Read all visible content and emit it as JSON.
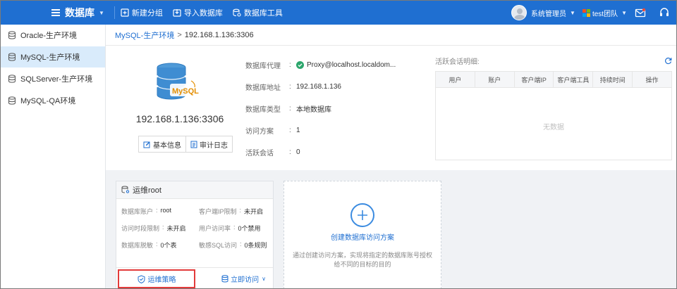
{
  "topbar": {
    "title": "数据库",
    "tools": [
      "新建分组",
      "导入数据库",
      "数据库工具"
    ],
    "user": "系统管理员",
    "team": "test团队"
  },
  "sidebar": {
    "items": [
      {
        "label": "Oracle-生产环境"
      },
      {
        "label": "MySQL-生产环境"
      },
      {
        "label": "SQLServer-生产环境"
      },
      {
        "label": "MySQL-QA环境"
      }
    ]
  },
  "breadcrumb": {
    "parent": "MySQL-生产环境",
    "sep": ">",
    "current": "192.168.1.136:3306"
  },
  "db": {
    "logo_text": "MySQL",
    "host": "192.168.1.136:3306",
    "basic_info": "基本信息",
    "audit_log": "审计日志",
    "props": [
      {
        "k": "数据库代理",
        "v": "Proxy@localhost.localdom..."
      },
      {
        "k": "数据库地址",
        "v": "192.168.1.136"
      },
      {
        "k": "数据库类型",
        "v": "本地数据库"
      },
      {
        "k": "访问方案",
        "v": "1"
      },
      {
        "k": "活跃会话",
        "v": "0"
      }
    ]
  },
  "sessions": {
    "title": "活跃会话明细:",
    "columns": [
      "用户",
      "账户",
      "客户端IP",
      "客户端工具",
      "持续时间",
      "操作"
    ],
    "empty": "无数据"
  },
  "account_card": {
    "title": "运维root",
    "fields": [
      {
        "k": "数据库账户",
        "v": "root"
      },
      {
        "k": "客户端IP限制",
        "v": "未开启"
      },
      {
        "k": "访问时段限制",
        "v": "未开启"
      },
      {
        "k": "用户访问率",
        "v": "0个禁用"
      },
      {
        "k": "数据库脱敏",
        "v": "0个表"
      },
      {
        "k": "敏感SQL访问",
        "v": "0条规则"
      }
    ],
    "policy": "运维策略",
    "access": "立即访问"
  },
  "create_card": {
    "title": "创建数据库访问方案",
    "desc": "通过创建访问方案，实现将指定的数据库账号授权给不同的目标的目的"
  }
}
